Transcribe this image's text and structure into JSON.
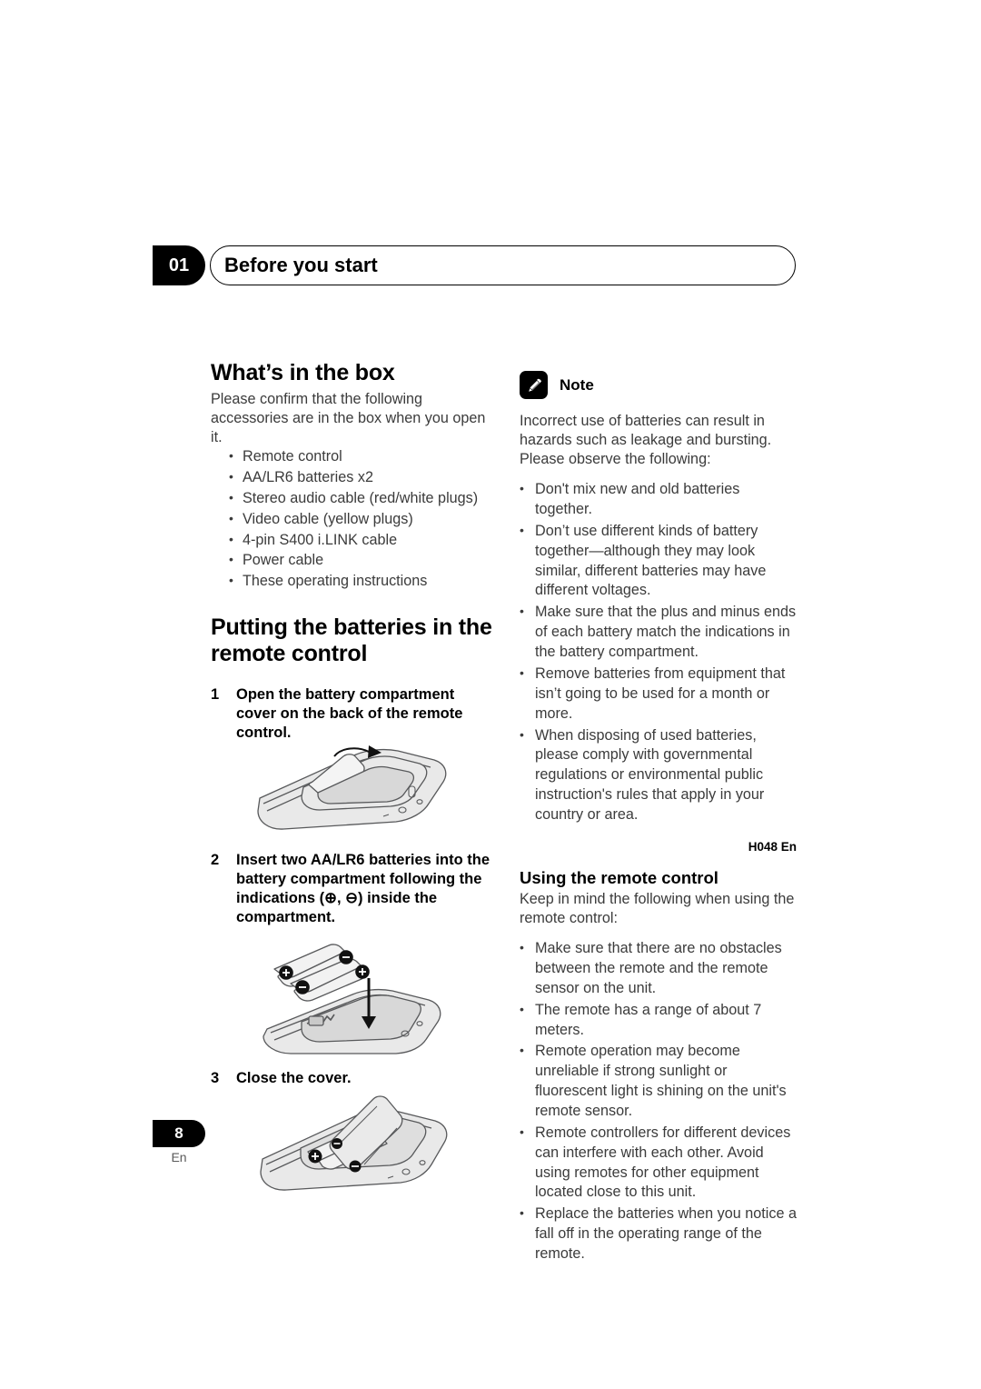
{
  "header": {
    "chapter_number": "01",
    "chapter_title": "Before you start"
  },
  "left_column": {
    "box_section": {
      "title": "What’s in the box",
      "intro": "Please confirm that the following accessories are in the box when you open it.",
      "items": [
        "Remote control",
        "AA/LR6 batteries x2",
        "Stereo audio cable (red/white plugs)",
        "Video cable (yellow plugs)",
        "4-pin S400 i.LINK cable",
        "Power cable",
        "These operating instructions"
      ]
    },
    "battery_section": {
      "title": "Putting the batteries in the remote control",
      "steps": [
        {
          "number": "1",
          "text": "Open the battery compartment cover on the back of the remote control.",
          "figure_name": "remote-cover-open-figure"
        },
        {
          "number": "2",
          "text": "Insert two AA/LR6 batteries into the battery compartment following the indications (⊕, ⊖) inside the compartment.",
          "figure_name": "remote-batteries-insert-figure"
        },
        {
          "number": "3",
          "text": "Close the cover.",
          "figure_name": "remote-cover-close-figure"
        }
      ]
    }
  },
  "right_column": {
    "note": {
      "icon": "pencil-note-icon",
      "label": "Note",
      "intro": "Incorrect use of batteries can result in hazards such as leakage and bursting. Please observe the following:",
      "items": [
        "Don't mix new and old batteries together.",
        "Don’t use different kinds of battery together—although they may look similar, different batteries may have different voltages.",
        "Make sure that the plus and minus ends of each battery match the indications in the battery compartment.",
        "Remove batteries from equipment that isn’t going to be used for a month or more.",
        "When disposing of used batteries, please comply with governmental regulations or environmental public instruction's rules that apply in your country or area."
      ],
      "code": "H048 En"
    },
    "using_remote": {
      "title": "Using the remote control",
      "intro": "Keep in mind the following when using the remote control:",
      "items": [
        "Make sure that there are no obstacles between the remote and the remote sensor on the unit.",
        "The remote has a range of about 7 meters.",
        "Remote operation may become unreliable if strong sunlight or fluorescent light is shining on the unit's remote sensor.",
        "Remote controllers for different devices can interfere with each other. Avoid using remotes for other equipment located close to this unit.",
        "Replace the batteries when you notice a fall off in the operating range of the remote."
      ]
    }
  },
  "footer": {
    "page_number": "8",
    "language": "En"
  },
  "colors": {
    "accent": "#000000",
    "body_text": "#3b3b3b",
    "figure_fill": "#e8e8e8",
    "figure_stroke": "#58595b"
  }
}
